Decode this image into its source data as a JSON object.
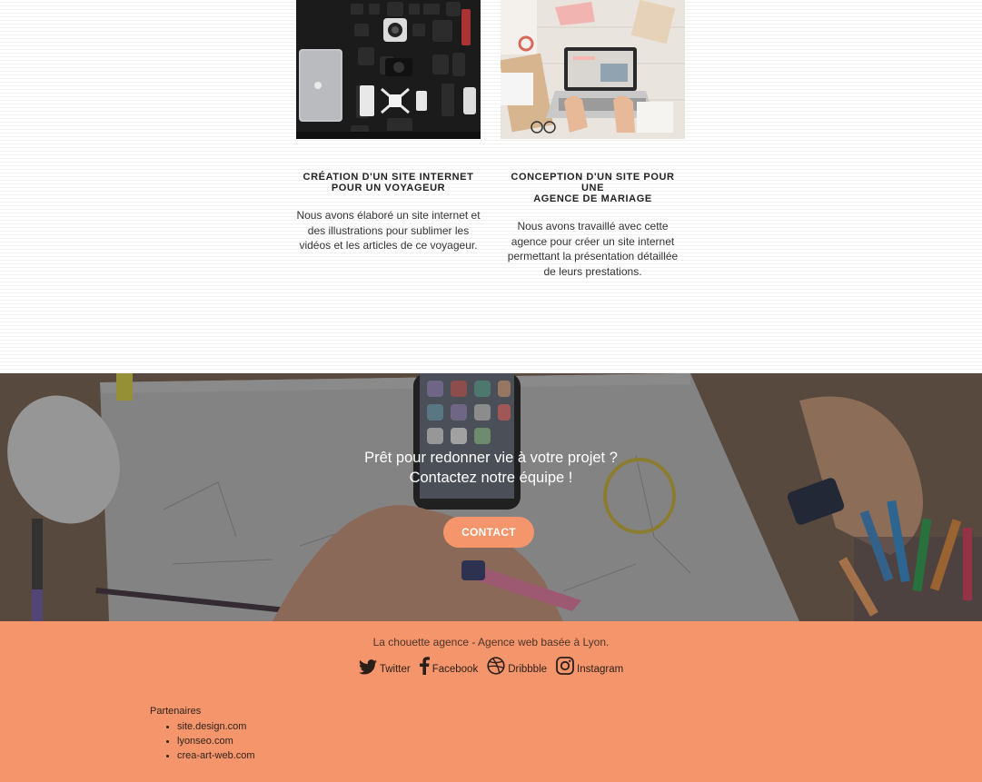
{
  "projects": [
    {
      "title_line1": "CRÉATION D'UN SITE INTERNET",
      "title_line2": "POUR UN VOYAGEUR",
      "description": "Nous avons élaboré un site internet et des illustrations pour sublimer les vidéos et les articles de ce voyageur."
    },
    {
      "title_line1": "CONCEPTION D'UN SITE POUR UNE",
      "title_line2": "AGENCE DE MARIAGE",
      "description": "Nous avons travaillé avec cette agence pour créer un site internet permettant la présentation détaillée de leurs prestations."
    }
  ],
  "cta": {
    "line1": "Prêt pour redonner vie à votre projet ?",
    "line2": "Contactez notre équipe !",
    "button_label": "CONTACT"
  },
  "footer": {
    "tagline": "La chouette agence - Agence web basée à Lyon.",
    "social": [
      {
        "label": "Twitter",
        "icon": "twitter-icon"
      },
      {
        "label": "Facebook",
        "icon": "facebook-icon"
      },
      {
        "label": "Dribbble",
        "icon": "dribbble-icon"
      },
      {
        "label": "Instagram",
        "icon": "instagram-icon"
      }
    ],
    "partners_title": "Partenaires",
    "partners": [
      "site.design.com",
      "lyonseo.com",
      "crea-art-web.com"
    ]
  },
  "colors": {
    "accent": "#f4956b",
    "text_dark": "#222222"
  }
}
